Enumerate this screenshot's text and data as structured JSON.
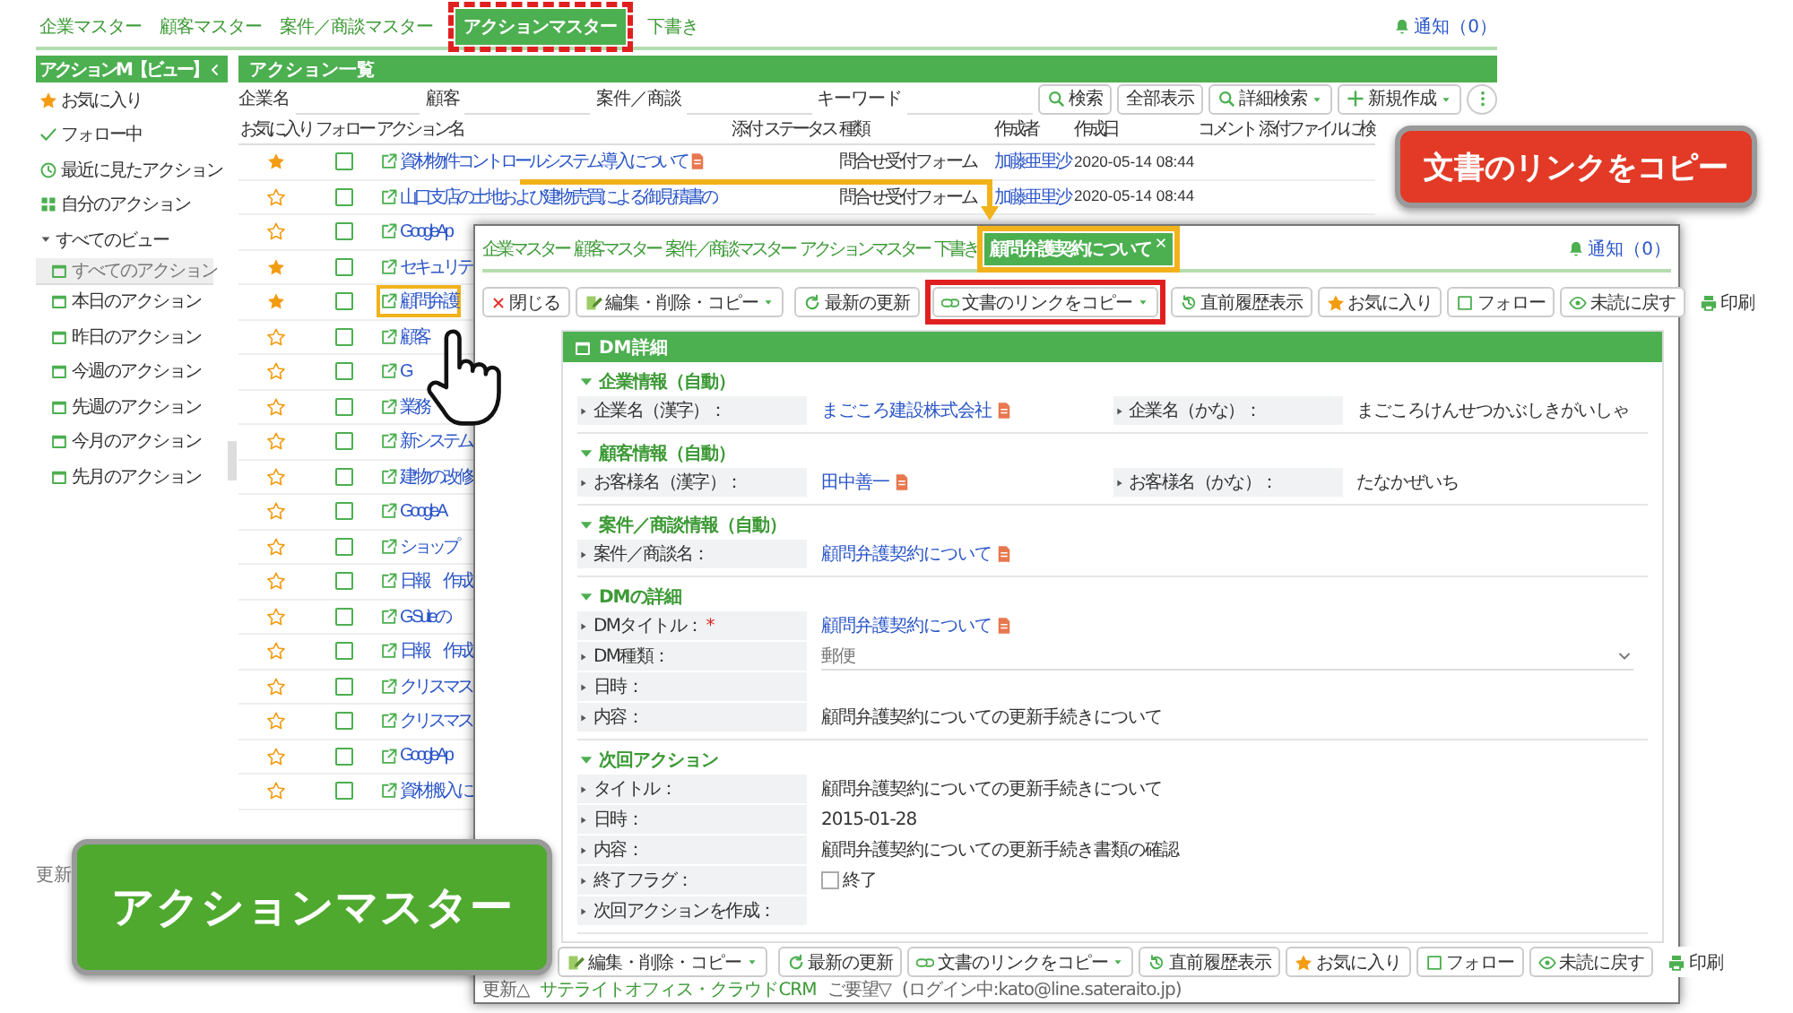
{
  "nav_tabs": [
    {
      "label": "企業マスター",
      "selected": false
    },
    {
      "label": "顧客マスター",
      "selected": false
    },
    {
      "label": "案件／商談マスター",
      "selected": false
    },
    {
      "label": "アクションマスター",
      "selected": true
    },
    {
      "label": "下書き",
      "selected": false
    }
  ],
  "notification": "通知（0）",
  "sidebar": {
    "title": "アクションM【ビュー】",
    "items": [
      {
        "label": "お気に入り",
        "kind": "star",
        "selected": false
      },
      {
        "label": "フォロー中",
        "kind": "check",
        "selected": false
      },
      {
        "label": "最近に見たアクション",
        "kind": "clock",
        "selected": false
      },
      {
        "label": "自分のアクション",
        "kind": "grid",
        "selected": false
      },
      {
        "label": "すべてのビュー",
        "kind": "group",
        "expanded": true,
        "children": [
          {
            "label": "すべてのアクション",
            "selected": true
          },
          {
            "label": "本日のアクション",
            "selected": false
          },
          {
            "label": "昨日のアクション",
            "selected": false
          },
          {
            "label": "今週のアクション",
            "selected": false
          },
          {
            "label": "先週のアクション",
            "selected": false
          },
          {
            "label": "今月のアクション",
            "selected": false
          },
          {
            "label": "先月のアクション",
            "selected": false
          }
        ]
      }
    ]
  },
  "footer": "更新",
  "list": {
    "title": "アクション一覧",
    "filters": [
      "企業名",
      "顧客",
      "案件／商談",
      "キーワード"
    ],
    "buttons": [
      {
        "label": "検索",
        "kind": "search"
      },
      {
        "label": "全部表示",
        "kind": "plain"
      },
      {
        "label": "詳細検索",
        "kind": "search-menu"
      },
      {
        "label": "新規作成",
        "kind": "new-menu"
      },
      {
        "kind": "more"
      }
    ],
    "columns": [
      "お気に入り",
      "フォロー",
      "アクション名",
      "添付",
      "ステータス",
      "種類",
      "作成者",
      "作成日",
      "コメント",
      "添付ファイルに検"
    ],
    "rows": [
      {
        "favorite": true,
        "followed": false,
        "name": "資材物件コントロールシステム導入について",
        "attachment": true,
        "type": "問合せ受付フォーム",
        "author": "加藤亜里沙",
        "created": "2020-05-14 08:44"
      },
      {
        "favorite": false,
        "followed": false,
        "name": "山口支店の土地および建物売買による御見積書の",
        "type": "問合せ受付フォーム",
        "author": "加藤亜里沙",
        "created": "2020-05-14 08:44"
      },
      {
        "favorite": false,
        "followed": false,
        "name": "GoogleAp"
      },
      {
        "favorite": true,
        "followed": false,
        "name": "セキュリテ"
      },
      {
        "favorite": true,
        "followed": false,
        "name": "顧問弁護",
        "highlighted": true
      },
      {
        "favorite": false,
        "followed": false,
        "name": "顧客"
      },
      {
        "favorite": false,
        "followed": false,
        "name": "G"
      },
      {
        "favorite": false,
        "followed": false,
        "name": "業務"
      },
      {
        "favorite": false,
        "followed": false,
        "name": "新システム"
      },
      {
        "favorite": false,
        "followed": false,
        "name": "建物の改修"
      },
      {
        "favorite": false,
        "followed": false,
        "name": "Google A"
      },
      {
        "favorite": false,
        "followed": false,
        "name": "ショップ"
      },
      {
        "favorite": false,
        "followed": false,
        "name": "日報　作成"
      },
      {
        "favorite": false,
        "followed": false,
        "name": "G Suiteの"
      },
      {
        "favorite": false,
        "followed": false,
        "name": "日報　作成"
      },
      {
        "favorite": false,
        "followed": false,
        "name": "クリスマス"
      },
      {
        "favorite": false,
        "followed": false,
        "name": "クリスマス"
      },
      {
        "favorite": false,
        "followed": false,
        "name": "GoogleAp"
      },
      {
        "favorite": false,
        "followed": false,
        "name": "資材搬入に"
      }
    ]
  },
  "detail_window": {
    "nav_tabs": [
      {
        "label": "企業マスター",
        "selected": false
      },
      {
        "label": "顧客マスター",
        "selected": false
      },
      {
        "label": "案件／商談マスター",
        "selected": false
      },
      {
        "label": "アクションマスター",
        "selected": false
      },
      {
        "label": "下書き",
        "selected": false
      }
    ],
    "open_tab": {
      "label": "顧問弁護契約について",
      "selected": true
    },
    "notification": "通知（0）",
    "toolbar_left": [
      {
        "label": "閉じる",
        "kind": "close"
      },
      {
        "label": "編集・削除・コピー",
        "kind": "edit",
        "menu": true
      }
    ],
    "toolbar_right": [
      {
        "label": "最新の更新",
        "kind": "refresh"
      },
      {
        "label": "文書のリンクをコピー",
        "kind": "link",
        "menu": true,
        "highlighted": true
      },
      {
        "label": "直前履歴表示",
        "kind": "history"
      },
      {
        "label": "お気に入り",
        "kind": "star"
      },
      {
        "label": "フォロー",
        "kind": "square"
      },
      {
        "label": "未読に戻す",
        "kind": "eye"
      },
      {
        "label": "印刷",
        "kind": "print"
      }
    ],
    "panel": {
      "title": "DM詳細",
      "sections": [
        {
          "title": "企業情報（自動）",
          "kind": "pair",
          "fields": [
            {
              "label": "企業名（漢字）：",
              "value": "まごころ建設株式会社",
              "kind": "link"
            },
            {
              "label": "企業名（かな）：",
              "value": "まごころけんせつかぶしきがいしゃ",
              "kind": "text"
            }
          ]
        },
        {
          "title": "顧客情報（自動）",
          "kind": "pair",
          "fields": [
            {
              "label": "お客様名（漢字）：",
              "value": "田中善一",
              "kind": "link"
            },
            {
              "label": "お客様名（かな）：",
              "value": "たなかぜいち",
              "kind": "text"
            }
          ]
        },
        {
          "title": "案件／商談情報（自動）",
          "kind": "list",
          "fields": [
            {
              "label": "案件／商談名：",
              "value": "顧問弁護契約について",
              "kind": "link"
            }
          ]
        },
        {
          "title": "DMの詳細",
          "kind": "list",
          "fields": [
            {
              "label": "DMタイトル：",
              "required_mark": "*",
              "value": "顧問弁護契約について",
              "kind": "link"
            },
            {
              "label": "DM種類：",
              "value": "郵便",
              "kind": "select"
            },
            {
              "label": "日時：",
              "kind": "text"
            },
            {
              "label": "内容：",
              "value": "顧問弁護契約についての更新手続きについて",
              "kind": "text"
            }
          ]
        },
        {
          "title": "次回アクション",
          "kind": "list",
          "fields": [
            {
              "label": "タイトル：",
              "value": "顧問弁護契約についての更新手続きについて",
              "kind": "text"
            },
            {
              "label": "日時：",
              "value": "2015-01-28",
              "kind": "text"
            },
            {
              "label": "内容：",
              "value": "顧問弁護契約についての更新手続き書類の確認",
              "kind": "text"
            },
            {
              "label": "終了フラグ：",
              "value": "終了",
              "kind": "checkbox",
              "checked": false
            },
            {
              "label": "次回アクションを作成：",
              "kind": "text"
            }
          ]
        }
      ]
    },
    "bottom_toolbar_left": [
      {
        "label": "編集・削除・コピー",
        "kind": "edit",
        "menu": true
      }
    ],
    "bottom_toolbar_right": [
      {
        "label": "最新の更新",
        "kind": "refresh"
      },
      {
        "label": "文書のリンクをコピー",
        "kind": "link",
        "menu": true
      },
      {
        "label": "直前履歴表示",
        "kind": "history"
      },
      {
        "label": "お気に入り",
        "kind": "star"
      },
      {
        "label": "フォロー",
        "kind": "square"
      },
      {
        "label": "未読に戻す",
        "kind": "eye"
      },
      {
        "label": "印刷",
        "kind": "print"
      }
    ],
    "status_bar": {
      "update": "更新△",
      "product": "サテライトオフィス・クラウドCRM",
      "request": "ご要望▽",
      "login": "(ログイン中:kato@line.sateraito.jp)"
    }
  },
  "callouts": [
    {
      "text": "文書のリンクをコピー",
      "color": "#e23a26"
    },
    {
      "text": "アクションマスター",
      "color": "#4fa92f"
    }
  ]
}
